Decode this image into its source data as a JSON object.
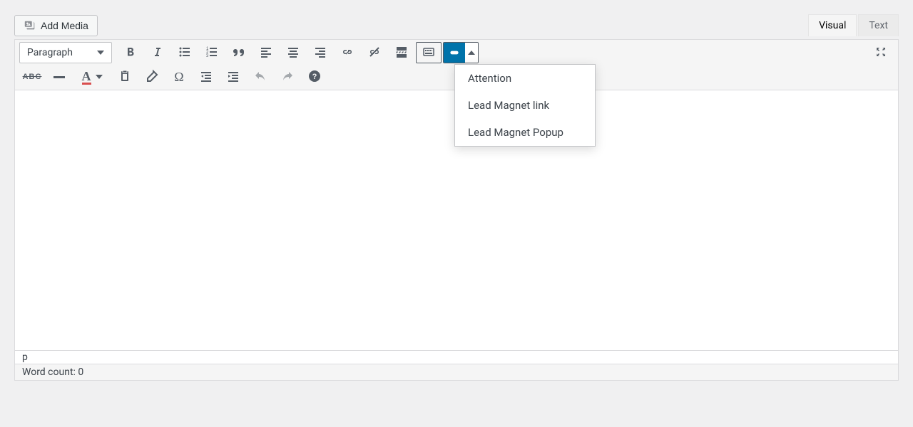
{
  "buttons": {
    "add_media": "Add Media"
  },
  "tabs": {
    "visual": "Visual",
    "text": "Text"
  },
  "toolbar": {
    "format": "Paragraph",
    "dropdown_items": [
      "Attention",
      "Lead Magnet link",
      "Lead Magnet Popup"
    ]
  },
  "status": {
    "path": "p",
    "word_count_label": "Word count: ",
    "word_count_value": "0"
  }
}
